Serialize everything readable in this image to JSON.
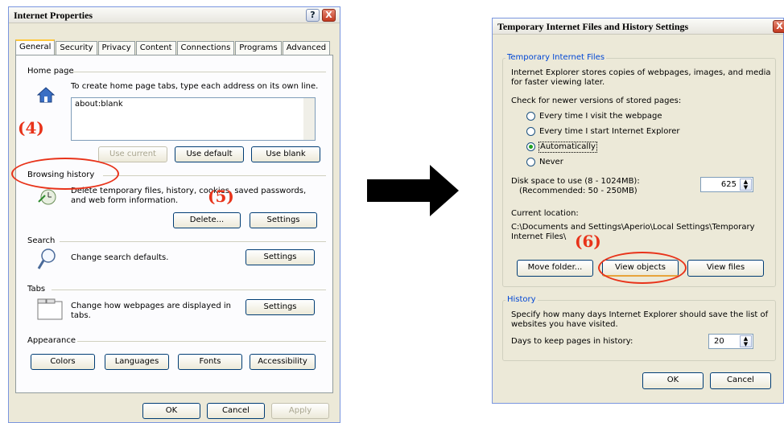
{
  "left": {
    "title": "Internet Properties",
    "help": "?",
    "close": "X",
    "tabs": [
      "General",
      "Security",
      "Privacy",
      "Content",
      "Connections",
      "Programs",
      "Advanced"
    ],
    "home_page": {
      "heading": "Home page",
      "desc": "To create home page tabs, type each address on its own line.",
      "value": "about:blank",
      "btn_current": "Use current",
      "btn_default": "Use default",
      "btn_blank": "Use blank"
    },
    "history": {
      "heading": "Browsing history",
      "desc": "Delete temporary files, history, cookies, saved passwords, and web form information.",
      "btn_delete": "Delete...",
      "btn_settings": "Settings"
    },
    "search": {
      "heading": "Search",
      "desc": "Change search defaults.",
      "btn_settings": "Settings"
    },
    "tabs_group": {
      "heading": "Tabs",
      "desc": "Change how webpages are displayed in tabs.",
      "btn_settings": "Settings"
    },
    "appearance": {
      "heading": "Appearance",
      "btn_colors": "Colors",
      "btn_languages": "Languages",
      "btn_fonts": "Fonts",
      "btn_accessibility": "Accessibility"
    },
    "footer": {
      "ok": "OK",
      "cancel": "Cancel",
      "apply": "Apply"
    }
  },
  "right": {
    "title": "Temporary Internet Files and History Settings",
    "close": "X",
    "tif": {
      "legend": "Temporary Internet Files",
      "desc": "Internet Explorer stores copies of webpages, images, and media for faster viewing later.",
      "check_label": "Check for newer versions of stored pages:",
      "options": [
        "Every time I visit the webpage",
        "Every time I start Internet Explorer",
        "Automatically",
        "Never"
      ],
      "selected": "Automatically",
      "disk_label": "Disk space to use (8 - 1024MB):",
      "disk_rec": "(Recommended: 50 - 250MB)",
      "disk_value": "625",
      "loc_label": "Current location:",
      "loc_value": "C:\\Documents and Settings\\Aperio\\Local Settings\\Temporary Internet Files\\",
      "btn_move": "Move folder...",
      "btn_view_objects": "View objects",
      "btn_view_files": "View files"
    },
    "history": {
      "legend": "History",
      "desc": "Specify how many days Internet Explorer should save the list of websites you have visited.",
      "days_label": "Days to keep pages in history:",
      "days_value": "20"
    },
    "footer": {
      "ok": "OK",
      "cancel": "Cancel"
    }
  },
  "annotations": {
    "a4": "(4)",
    "a5": "(5)",
    "a6": "(6)"
  },
  "colors": {
    "annotation": "#e8331a",
    "arrow": "#000000"
  }
}
